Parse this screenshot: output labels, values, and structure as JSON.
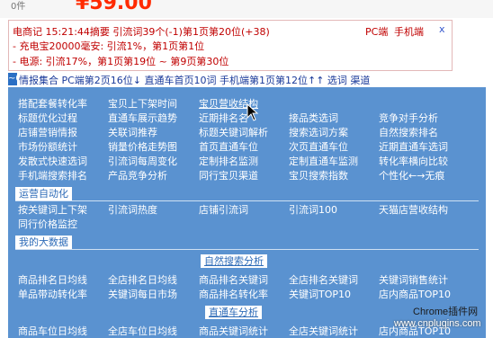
{
  "top": {
    "small": "0件",
    "price": "¥59.00"
  },
  "info_box": {
    "line1": "电商记 15:21:44摘要 引流词39个(-1)第1页第20位(+38)",
    "line2": "- 充电宝20000毫安: 引流1%，第1页第1位",
    "line3": "- 电源: 引流17%，第1页第19位 ~ 第9页第30位",
    "pc": "PC端",
    "mobile": "手机端",
    "close": "x"
  },
  "info_bar": {
    "badge": "~0",
    "text": "情报集合  PC端第2页16位↓  直通车首页10词 手机端第1页第12位↑↑ 选词 渠道"
  },
  "menu": {
    "grid": [
      [
        "搭配套餐转化率",
        "宝贝上下架时间",
        "宝贝营收结构",
        "",
        "接品类选词",
        "竞争对手分析"
      ],
      [
        "标题优化过程",
        "直通车展示趋势",
        "近期排名名",
        "",
        "搜索选词方案",
        "自然搜索排名"
      ],
      [
        "店铺营销情报",
        "关联词推荐",
        "标题关键词解析",
        "",
        "搜索选词方案",
        "自然搜索排名"
      ],
      [
        "市场份额统计",
        "销量价格走势图",
        "首页直通车位",
        "",
        "次页直通车位",
        "近期直通车选词"
      ],
      [
        "发散式快速选词",
        "引流词每周变化",
        "定制排名监测",
        "",
        "定制直通车监测",
        "转化率横向比较"
      ],
      [
        "手机端搜索排名",
        "产品竞争分析",
        "同行宝贝渠道",
        "",
        "宝贝搜索指数",
        "个性化←→无痕"
      ]
    ],
    "sec_ops": "运营自动化",
    "ops": [
      "按关键词上下架",
      "引流词热度",
      "店铺引流词",
      "引流词100",
      "天猫店营收结构"
    ],
    "ops2": "同行价格监控",
    "sec_data": "我的大数据",
    "sec_natural": "自然搜索分析",
    "natural_r1": [
      "商品排名日均线",
      "全店排名日均线",
      "商品排名关键词",
      "全店排名关键词",
      "关键词销售统计"
    ],
    "natural_r2": [
      "单品带动转化率",
      "关键词每日市场",
      "商品排名转化率",
      "关键词TOP10",
      "店内商品TOP10"
    ],
    "sec_ztc": "直通车分析",
    "ztc_r1": [
      "商品车位日均线",
      "全店车位日均线",
      "商品关键词统计",
      "全店关键词统计",
      "店内商品TOP10"
    ]
  },
  "watermark": {
    "l1": "Chrome插件网",
    "l2": "www.cnplugins.com"
  }
}
